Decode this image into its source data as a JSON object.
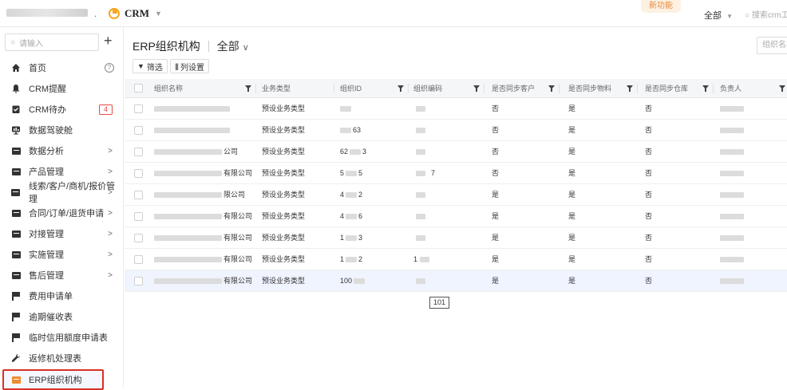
{
  "topbar": {
    "brand_separator": ".",
    "app_name": "CRM",
    "new_feature_label": "新功能",
    "scope_label": "全部",
    "search_placeholder": "搜索crm工"
  },
  "sidebar": {
    "search_placeholder": "请输入",
    "add_label": "+",
    "items": [
      {
        "label": "首页",
        "icon": "home-icon"
      },
      {
        "label": "CRM提醒",
        "icon": "bell-icon"
      },
      {
        "label": "CRM待办",
        "icon": "todo-icon",
        "badge": "4"
      },
      {
        "label": "数据驾驶舱",
        "icon": "dashboard-icon"
      },
      {
        "label": "数据分析",
        "icon": "folder-icon",
        "chevron": ">"
      },
      {
        "label": "产品管理",
        "icon": "folder-icon",
        "chevron": ">"
      },
      {
        "label": "线索/客户/商机/报价管理",
        "icon": "folder-icon",
        "chevron": ">"
      },
      {
        "label": "合同/订单/退货申请",
        "icon": "folder-icon",
        "chevron": ">"
      },
      {
        "label": "对接管理",
        "icon": "folder-icon",
        "chevron": ">"
      },
      {
        "label": "实施管理",
        "icon": "folder-icon",
        "chevron": ">"
      },
      {
        "label": "售后管理",
        "icon": "folder-icon",
        "chevron": ">"
      },
      {
        "label": "费用申请单",
        "icon": "flag-icon"
      },
      {
        "label": "逾期催收表",
        "icon": "flag-icon"
      },
      {
        "label": "临时信用额度申请表",
        "icon": "flag-icon"
      },
      {
        "label": "返修机处理表",
        "icon": "wrench-icon"
      },
      {
        "label": "ERP组织机构",
        "icon": "folder-icon",
        "active": true
      }
    ]
  },
  "main": {
    "title": "ERP组织机构",
    "view_label": "全部",
    "search_placeholder": "组织名称",
    "filter_label": "筛选",
    "column_settings_label": "列设置",
    "columns": [
      "组织名称",
      "业务类型",
      "组织ID",
      "组织编码",
      "是否同步客户",
      "是否同步物料",
      "是否同步仓库",
      "负责人"
    ],
    "rows": [
      {
        "name_suffix": "",
        "biz": "预设业务类型",
        "id_prefix": "",
        "id_suffix": "",
        "code_prefix": "",
        "code_suffix": "",
        "sync_customer": "否",
        "sync_material": "是",
        "sync_warehouse": "否"
      },
      {
        "name_suffix": "",
        "biz": "预设业务类型",
        "id_prefix": "",
        "id_suffix": "63",
        "code_prefix": "",
        "code_suffix": "",
        "sync_customer": "否",
        "sync_material": "是",
        "sync_warehouse": "否"
      },
      {
        "name_suffix": "公司",
        "biz": "预设业务类型",
        "id_prefix": "62",
        "id_suffix": "3",
        "code_prefix": "",
        "code_suffix": "",
        "sync_customer": "否",
        "sync_material": "是",
        "sync_warehouse": "否"
      },
      {
        "name_suffix": "有限公司",
        "biz": "预设业务类型",
        "id_prefix": "5",
        "id_suffix": "5",
        "code_prefix": "",
        "code_suffix": "7",
        "sync_customer": "否",
        "sync_material": "是",
        "sync_warehouse": "否"
      },
      {
        "name_suffix": "限公司",
        "biz": "预设业务类型",
        "id_prefix": "4",
        "id_suffix": "2",
        "code_prefix": "",
        "code_suffix": "",
        "sync_customer": "是",
        "sync_material": "是",
        "sync_warehouse": "否"
      },
      {
        "name_suffix": "有限公司",
        "biz": "预设业务类型",
        "id_prefix": "4",
        "id_suffix": "6",
        "code_prefix": "",
        "code_suffix": "",
        "sync_customer": "是",
        "sync_material": "是",
        "sync_warehouse": "否"
      },
      {
        "name_suffix": "有限公司",
        "biz": "预设业务类型",
        "id_prefix": "1",
        "id_suffix": "3",
        "code_prefix": "",
        "code_suffix": "",
        "sync_customer": "是",
        "sync_material": "是",
        "sync_warehouse": "否"
      },
      {
        "name_suffix": "有限公司",
        "biz": "预设业务类型",
        "id_prefix": "1",
        "id_suffix": "2",
        "code_prefix": "1",
        "code_suffix": "",
        "sync_customer": "是",
        "sync_material": "是",
        "sync_warehouse": "否"
      },
      {
        "name_suffix": "有限公司",
        "biz": "预设业务类型",
        "id_prefix": "100",
        "id_suffix": "",
        "code_prefix": "",
        "code_suffix": "",
        "sync_customer": "是",
        "sync_material": "是",
        "sync_warehouse": "否",
        "highlighted": true
      }
    ],
    "tooltip_value": "101"
  },
  "colors": {
    "accent_orange": "#f5a623",
    "active_border": "#d93025",
    "badge_red": "#e84a4a"
  }
}
